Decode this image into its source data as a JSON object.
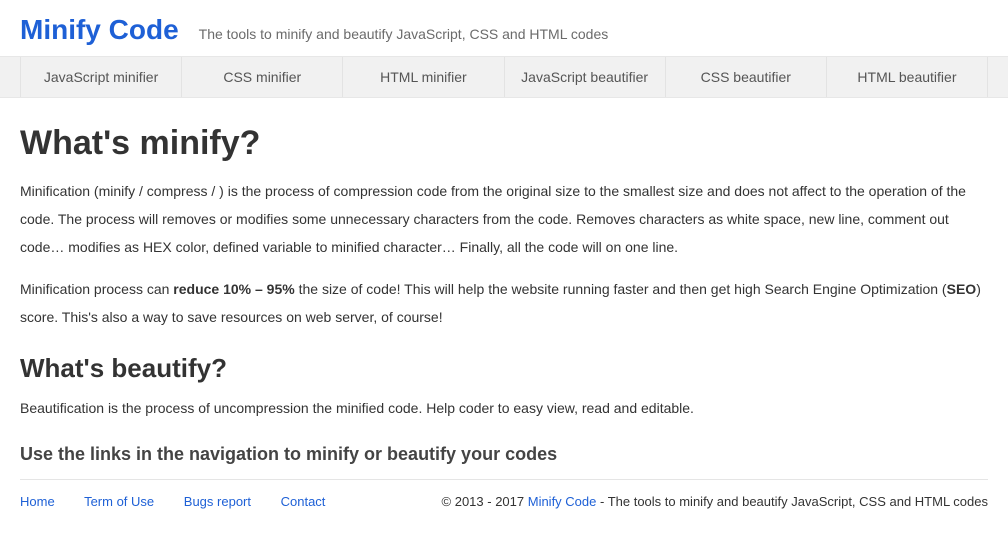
{
  "header": {
    "brand": "Minify Code",
    "tagline": "The tools to minify and beautify JavaScript, CSS and HTML codes"
  },
  "nav": {
    "items": [
      "JavaScript minifier",
      "CSS minifier",
      "HTML minifier",
      "JavaScript beautifier",
      "CSS beautifier",
      "HTML beautifier"
    ]
  },
  "content": {
    "h1": "What's minify?",
    "p1": "Minification (minify / compress / ) is the process of compression code from the original size to the smallest size and does not affect to the operation of the code. The process will removes or modifies some unnecessary characters from the code. Removes characters as white space, new line, comment out code… modifies as HEX color, defined variable to minified character… Finally, all the code will on one line.",
    "p2_pre": "Minification process can ",
    "p2_bold1": "reduce 10% – 95%",
    "p2_mid": " the size of code! This will help the website running faster and then get high Search Engine Optimization (",
    "p2_bold2": "SEO",
    "p2_post": ") score. This's also a way to save resources on web server, of course!",
    "h2": "What's beautify?",
    "p3": "Beautification is the process of uncompression the minified code. Help coder to easy view, read and editable.",
    "h3": "Use the links in the navigation to minify or beautify your codes"
  },
  "footer": {
    "links": [
      "Home",
      "Term of Use",
      "Bugs report",
      "Contact"
    ],
    "copyright_pre": "© 2013 - 2017 ",
    "copyright_link": "Minify Code",
    "copyright_post": " - The tools to minify and beautify JavaScript, CSS and HTML codes"
  }
}
